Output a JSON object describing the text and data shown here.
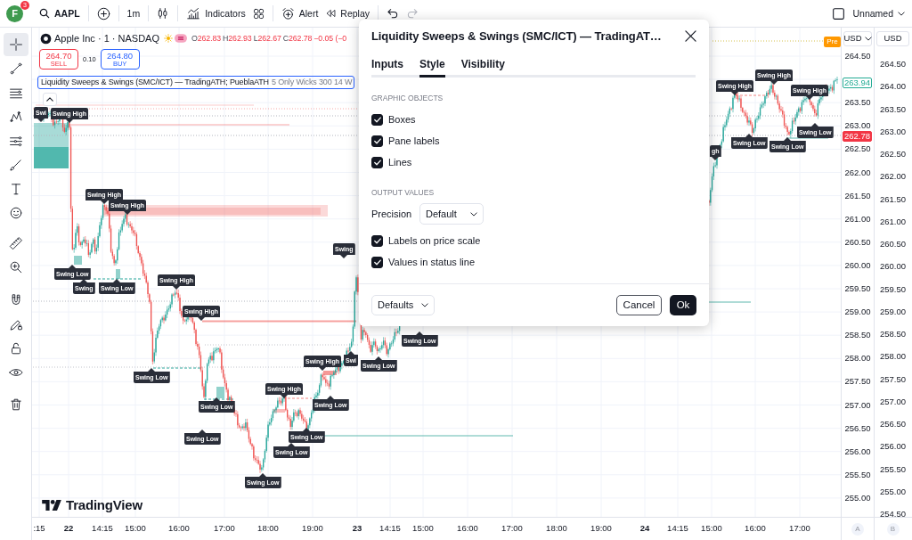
{
  "top_toolbar": {
    "avatar": "F",
    "notifications": "3",
    "symbol": "AAPL",
    "interval": "1m",
    "indicators": "Indicators",
    "alert": "Alert",
    "replay": "Replay",
    "undo": {
      "disabled": false
    },
    "redo": {
      "disabled": true
    },
    "layout_name": "Unnamed"
  },
  "drawing_tools": [
    {
      "selected": true
    },
    {
      "selected": false
    },
    {
      "selected": false
    },
    {
      "selected": false
    },
    {
      "selected": false
    },
    {
      "selected": false
    },
    {
      "selected": false
    },
    {
      "selected": false
    },
    {
      "selected": false
    },
    {
      "selected": false
    },
    {
      "selected": false
    },
    {
      "selected": false
    },
    {
      "selected": false
    },
    {
      "selected": false
    },
    {
      "selected": false
    }
  ],
  "legend": {
    "title": "Apple Inc · 1 · NASDAQ",
    "values": [
      {
        "label": "O",
        "value": "262.83"
      },
      {
        "label": "H",
        "value": "262.93"
      },
      {
        "label": "L",
        "value": "262.67"
      },
      {
        "label": "C",
        "value": "262.78"
      }
    ],
    "change": "−0.05 (−0",
    "sell": {
      "price": "264.70",
      "label": "SELL"
    },
    "spread": "0.10",
    "buy": {
      "price": "264.80",
      "label": "BUY"
    },
    "indicator": {
      "name": "Liquidity Sweeps & Swings (SMC/ICT) — TradingATH; PueblaATH",
      "inputs": "5 Only Wicks 300 14 W"
    }
  },
  "chart": {
    "session_badge": "Pre",
    "logo": "TradingView",
    "swing_labels": [
      {
        "kind": "high",
        "text": "Swi"
      },
      {
        "kind": "high",
        "text": "Swing High"
      },
      {
        "kind": "high",
        "text": "Swing High"
      },
      {
        "kind": "high",
        "text": "Swing High"
      },
      {
        "kind": "low",
        "text": "Swing Low"
      },
      {
        "kind": "low",
        "text": "Swing"
      },
      {
        "kind": "low",
        "text": "Swing Low"
      },
      {
        "kind": "high",
        "text": "Swing High"
      },
      {
        "kind": "high",
        "text": "Swing High"
      },
      {
        "kind": "low",
        "text": "Swing Low"
      },
      {
        "kind": "low",
        "text": "Swing Low"
      },
      {
        "kind": "low",
        "text": "Swing Low"
      },
      {
        "kind": "high",
        "text": "Swing High"
      },
      {
        "kind": "low",
        "text": "Swing Low"
      },
      {
        "kind": "low",
        "text": "Swing Low"
      },
      {
        "kind": "low",
        "text": "Swing Low"
      },
      {
        "kind": "high",
        "text": "Swing High"
      },
      {
        "kind": "low",
        "text": "Swing Low"
      },
      {
        "kind": "high",
        "text": "Swing"
      },
      {
        "kind": "low",
        "text": "Swi"
      },
      {
        "kind": "low",
        "text": "Swing Low"
      },
      {
        "kind": "low",
        "text": "Swing Low"
      },
      {
        "kind": "high",
        "text": "Swing High"
      },
      {
        "kind": "high",
        "text": "Swing High"
      },
      {
        "kind": "high",
        "text": "Swing High"
      },
      {
        "kind": "low",
        "text": "Swing Low"
      },
      {
        "kind": "low",
        "text": "Swing Low"
      },
      {
        "kind": "low",
        "text": "Swing Low"
      },
      {
        "kind": "high",
        "text": "gh"
      }
    ]
  },
  "price_scale_a": {
    "currency": "USD",
    "ticks": [
      "264.50",
      "263.50",
      "263.00",
      "262.50",
      "262.00",
      "261.50",
      "261.00",
      "260.50",
      "260.00",
      "259.50",
      "259.00",
      "258.50",
      "258.00",
      "257.50",
      "257.00",
      "256.50",
      "256.00",
      "255.50",
      "255.00"
    ],
    "tags": [
      {
        "text": "263.94",
        "kind": "outline",
        "color": "#22ab94"
      },
      {
        "text": "262.78",
        "kind": "filled",
        "color": "#f23645"
      }
    ],
    "corner": "A"
  },
  "price_scale_b": {
    "currency": "USD",
    "ticks": [
      "264.50",
      "264.00",
      "263.50",
      "263.00",
      "262.50",
      "262.00",
      "261.50",
      "261.00",
      "260.50",
      "260.00",
      "259.50",
      "259.00",
      "258.50",
      "258.00",
      "257.50",
      "257.00",
      "256.50",
      "256.00",
      "255.50",
      "255.00",
      "254.50"
    ],
    "corner": "B"
  },
  "time_scale": [
    {
      "text": ":15",
      "kind": "time"
    },
    {
      "text": "22",
      "kind": "day"
    },
    {
      "text": "14:15",
      "kind": "time"
    },
    {
      "text": "15:00",
      "kind": "time"
    },
    {
      "text": "16:00",
      "kind": "time"
    },
    {
      "text": "17:00",
      "kind": "time"
    },
    {
      "text": "18:00",
      "kind": "time"
    },
    {
      "text": "19:00",
      "kind": "time"
    },
    {
      "text": "23",
      "kind": "day"
    },
    {
      "text": "14:15",
      "kind": "time"
    },
    {
      "text": "15:00",
      "kind": "time"
    },
    {
      "text": "16:00",
      "kind": "time"
    },
    {
      "text": "17:00",
      "kind": "time"
    },
    {
      "text": "18:00",
      "kind": "time"
    },
    {
      "text": "19:00",
      "kind": "time"
    },
    {
      "text": "24",
      "kind": "day"
    },
    {
      "text": "14:15",
      "kind": "time"
    },
    {
      "text": "15:00",
      "kind": "time"
    },
    {
      "text": "16:00",
      "kind": "time"
    },
    {
      "text": "17:00",
      "kind": "time"
    }
  ],
  "dialog": {
    "title": "Liquidity Sweeps & Swings (SMC/ICT) — TradingAT…",
    "tabs": [
      {
        "label": "Inputs",
        "selected": false
      },
      {
        "label": "Style",
        "selected": true
      },
      {
        "label": "Visibility",
        "selected": false
      }
    ],
    "sections": [
      {
        "heading": "GRAPHIC OBJECTS",
        "rows": [
          {
            "kind": "checkbox",
            "label": "Boxes",
            "checked": true
          },
          {
            "kind": "checkbox",
            "label": "Pane labels",
            "checked": true
          },
          {
            "kind": "checkbox",
            "label": "Lines",
            "checked": true
          }
        ]
      },
      {
        "heading": "OUTPUT VALUES",
        "rows": [
          {
            "kind": "select",
            "label": "Precision",
            "value": "Default"
          },
          {
            "kind": "checkbox",
            "label": "Labels on price scale",
            "checked": true
          },
          {
            "kind": "checkbox",
            "label": "Values in status line",
            "checked": true
          }
        ]
      }
    ],
    "defaults": "Defaults",
    "cancel": "Cancel",
    "ok": "Ok"
  }
}
